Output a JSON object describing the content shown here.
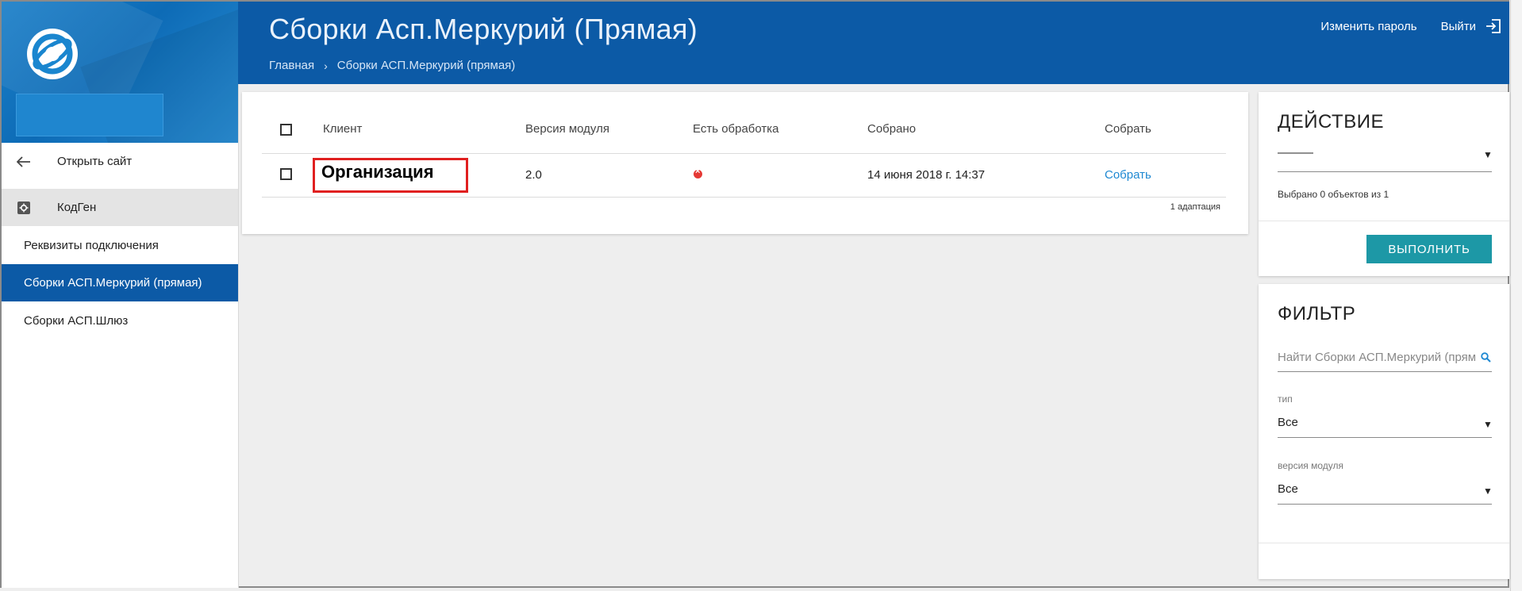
{
  "header": {
    "title": "Сборки Асп.Меркурий (Прямая)",
    "breadcrumb": [
      "Главная",
      "Сборки АСП.Меркурий (прямая)"
    ],
    "change_password": "Изменить пароль",
    "logout": "Выйти"
  },
  "sidebar": {
    "open_site": "Открыть сайт",
    "group": "КодГен",
    "items": [
      {
        "label": "Реквизиты подключения"
      },
      {
        "label": "Сборки АСП.Меркурий (прямая)"
      },
      {
        "label": "Сборки АСП.Шлюз"
      }
    ]
  },
  "table": {
    "columns": [
      "Клиент",
      "Версия модуля",
      "Есть обработка",
      "Собрано",
      "Собрать"
    ],
    "rows": [
      {
        "client": "Организация",
        "version": "2.0",
        "has_processing": false,
        "collected": "14 июня 2018 г. 14:37",
        "action": "Собрать"
      }
    ],
    "count": "1 адаптация"
  },
  "action_panel": {
    "title": "ДЕЙСТВИЕ",
    "selected_value": "———",
    "selected_info": "Выбрано 0 объектов из 1",
    "run_label": "ВЫПОЛНИТЬ"
  },
  "filter_panel": {
    "title": "ФИЛЬТР",
    "search_placeholder": "Найти Сборки АСП.Меркурий (прямая)",
    "type_label": "тип",
    "type_value": "Все",
    "version_label": "версия модуля",
    "version_value": "Все"
  },
  "colors": {
    "primary": "#0c5aa6",
    "accent_button": "#1d98a6",
    "link": "#1e88d2",
    "error": "#e53935",
    "highlight_box": "#e02020"
  }
}
